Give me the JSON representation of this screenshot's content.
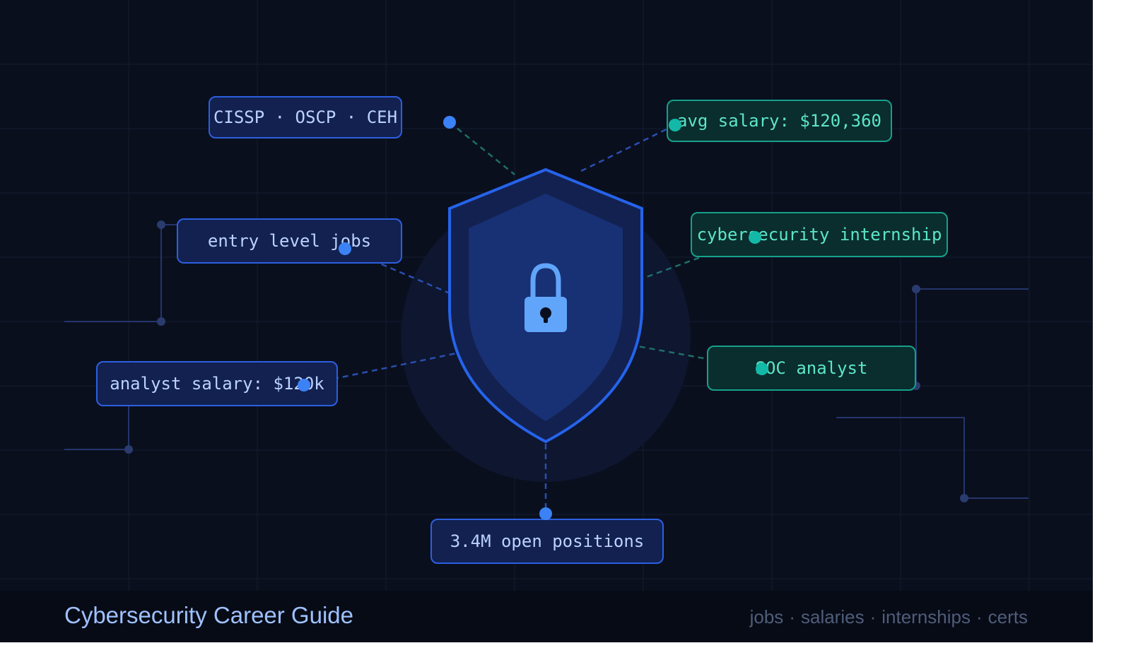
{
  "tags": {
    "certs": "CISSP · OSCP · CEH",
    "entry": "entry level jobs",
    "analyst_salary": "analyst salary: $120k",
    "avg_salary": "avg salary: $120,360",
    "internship": "cybersecurity internship",
    "soc": "SOC analyst",
    "positions": "3.4M open positions"
  },
  "footer": {
    "title": "Cybersecurity Career Guide",
    "links": [
      "jobs",
      "salaries",
      "internships",
      "certs"
    ],
    "separator": "·"
  },
  "colors": {
    "background": "#0a0f1e",
    "accent_blue": "#3b82f6",
    "accent_teal": "#14b8a6",
    "shield": "#2563eb",
    "lock": "#60a5fa"
  },
  "icons": [
    "shield-icon",
    "lock-icon"
  ]
}
